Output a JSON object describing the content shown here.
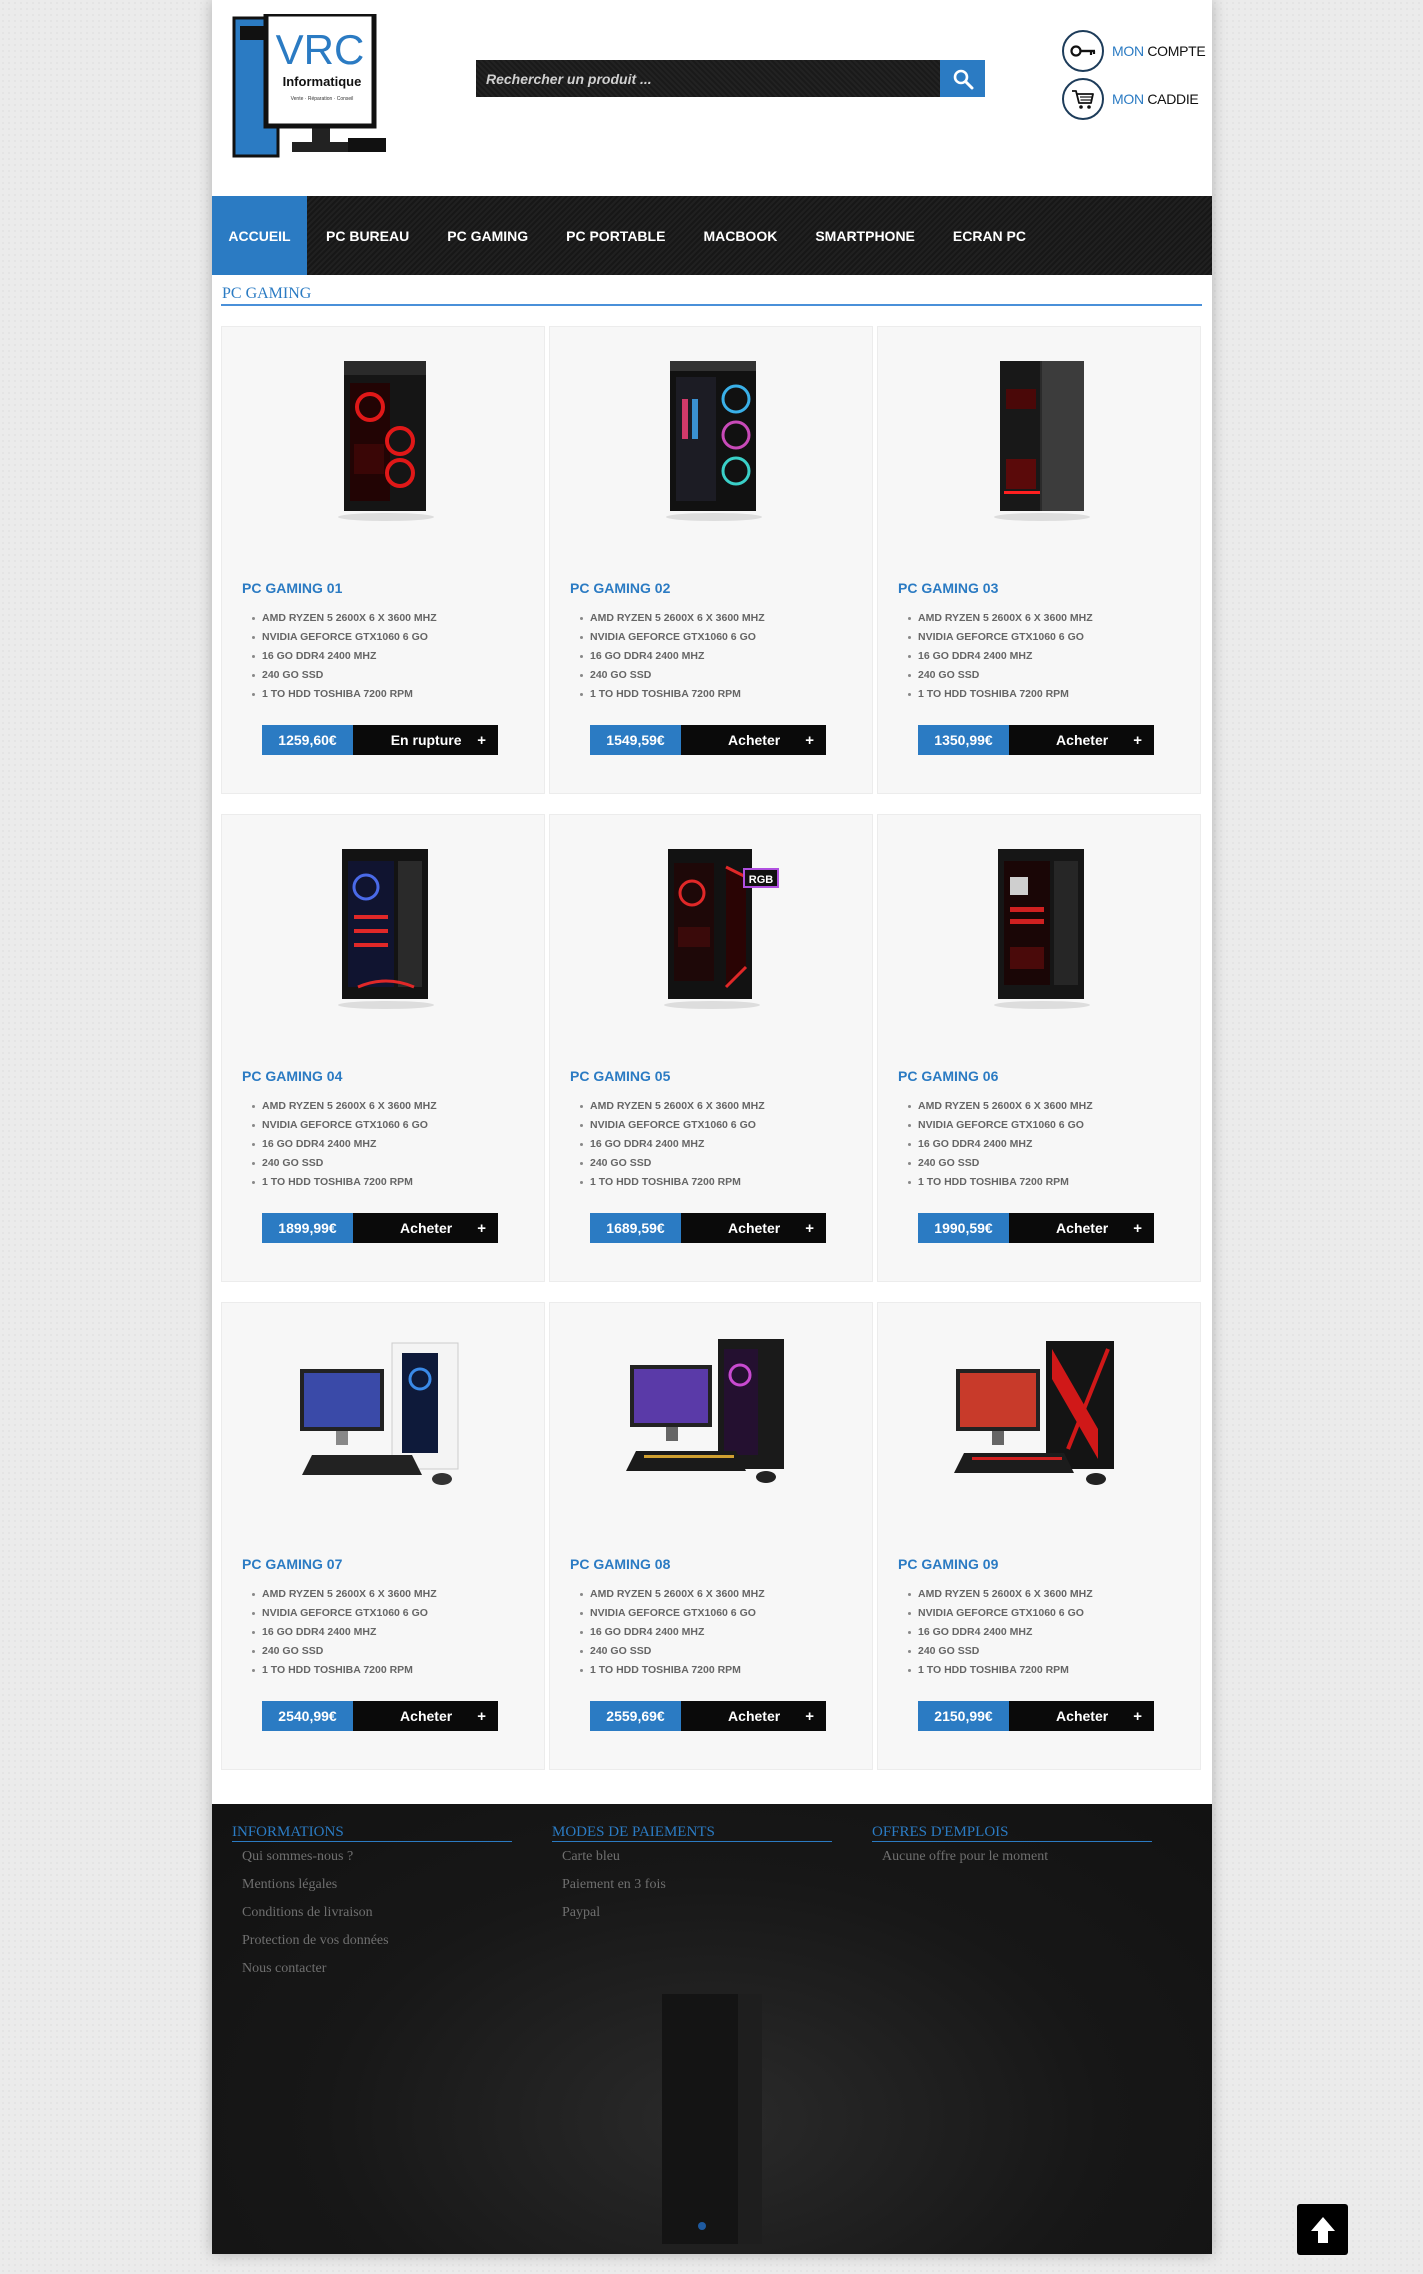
{
  "brand": {
    "logo_text": "VRC",
    "logo_sub": "Informatique",
    "logo_tagline": "Vente · Réparation · Conseil"
  },
  "search": {
    "placeholder": "Rechercher un produit ..."
  },
  "account": {
    "compte_prefix": "MON",
    "compte_label": "COMPTE",
    "caddie_prefix": "MON",
    "caddie_label": "CADDIE"
  },
  "nav": {
    "items": [
      {
        "label": "ACCUEIL"
      },
      {
        "label": "PC BUREAU"
      },
      {
        "label": "PC GAMING"
      },
      {
        "label": "PC PORTABLE"
      },
      {
        "label": "MACBOOK"
      },
      {
        "label": "SMARTPHONE"
      },
      {
        "label": "ECRAN PC"
      }
    ]
  },
  "section": {
    "title": "PC GAMING"
  },
  "products": [
    {
      "name": "PC GAMING 01",
      "price": "1259,60€",
      "action": "En rupture",
      "plus": "+",
      "specs": [
        "AMD RYZEN 5 2600X 6 X 3600 MHZ",
        "NVIDIA GEFORCE GTX1060 6 GO",
        "16 GO DDR4 2400 MHZ",
        "240 GO SSD",
        "1 TO HDD TOSHIBA 7200 RPM"
      ]
    },
    {
      "name": "PC GAMING 02",
      "price": "1549,59€",
      "action": "Acheter",
      "plus": "+",
      "specs": [
        "AMD RYZEN 5 2600X 6 X 3600 MHZ",
        "NVIDIA GEFORCE GTX1060 6 GO",
        "16 GO DDR4 2400 MHZ",
        "240 GO SSD",
        "1 TO HDD TOSHIBA 7200 RPM"
      ]
    },
    {
      "name": "PC GAMING 03",
      "price": "1350,99€",
      "action": "Acheter",
      "plus": "+",
      "specs": [
        "AMD RYZEN 5 2600X 6 X 3600 MHZ",
        "NVIDIA GEFORCE GTX1060 6 GO",
        "16 GO DDR4 2400 MHZ",
        "240 GO SSD",
        "1 TO HDD TOSHIBA 7200 RPM"
      ]
    },
    {
      "name": "PC GAMING 04",
      "price": "1899,99€",
      "action": "Acheter",
      "plus": "+",
      "specs": [
        "AMD RYZEN 5 2600X 6 X 3600 MHZ",
        "NVIDIA GEFORCE GTX1060 6 GO",
        "16 GO DDR4 2400 MHZ",
        "240 GO SSD",
        "1 TO HDD TOSHIBA 7200 RPM"
      ]
    },
    {
      "name": "PC GAMING 05",
      "price": "1689,59€",
      "action": "Acheter",
      "plus": "+",
      "badge": "RGB",
      "specs": [
        "AMD RYZEN 5 2600X 6 X 3600 MHZ",
        "NVIDIA GEFORCE GTX1060 6 GO",
        "16 GO DDR4 2400 MHZ",
        "240 GO SSD",
        "1 TO HDD TOSHIBA 7200 RPM"
      ]
    },
    {
      "name": "PC GAMING 06",
      "price": "1990,59€",
      "action": "Acheter",
      "plus": "+",
      "specs": [
        "AMD RYZEN 5 2600X 6 X 3600 MHZ",
        "NVIDIA GEFORCE GTX1060 6 GO",
        "16 GO DDR4 2400 MHZ",
        "240 GO SSD",
        "1 TO HDD TOSHIBA 7200 RPM"
      ]
    },
    {
      "name": "PC GAMING 07",
      "price": "2540,99€",
      "action": "Acheter",
      "plus": "+",
      "specs": [
        "AMD RYZEN 5 2600X 6 X 3600 MHZ",
        "NVIDIA GEFORCE GTX1060 6 GO",
        "16 GO DDR4 2400 MHZ",
        "240 GO SSD",
        "1 TO HDD TOSHIBA 7200 RPM"
      ]
    },
    {
      "name": "PC GAMING 08",
      "price": "2559,69€",
      "action": "Acheter",
      "plus": "+",
      "specs": [
        "AMD RYZEN 5 2600X 6 X 3600 MHZ",
        "NVIDIA GEFORCE GTX1060 6 GO",
        "16 GO DDR4 2400 MHZ",
        "240 GO SSD",
        "1 TO HDD TOSHIBA 7200 RPM"
      ]
    },
    {
      "name": "PC GAMING 09",
      "price": "2150,99€",
      "action": "Acheter",
      "plus": "+",
      "specs": [
        "AMD RYZEN 5 2600X 6 X 3600 MHZ",
        "NVIDIA GEFORCE GTX1060 6 GO",
        "16 GO DDR4 2400 MHZ",
        "240 GO SSD",
        "1 TO HDD TOSHIBA 7200 RPM"
      ]
    }
  ],
  "footer": {
    "informations": {
      "title": "INFORMATIONS",
      "links": [
        "Qui sommes-nous ?",
        "Mentions légales",
        "Conditions de livraison",
        "Protection de vos données",
        "Nous contacter"
      ]
    },
    "paiements": {
      "title": "MODES DE PAIEMENTS",
      "links": [
        "Carte bleu",
        "Paiement en 3 fois",
        "Paypal"
      ]
    },
    "emplois": {
      "title": "OFFRES D'EMPLOIS",
      "links": [
        "Aucune offre pour le moment"
      ]
    }
  },
  "colors": {
    "accent": "#2b7bc3",
    "nav_bg": "#1c1c1c",
    "footer_bg": "#161616",
    "card_bg": "#f7f7f7"
  },
  "icons": {
    "search": "search-icon",
    "account": "key-icon",
    "cart": "cart-icon",
    "back_to_top": "arrow-up-icon"
  }
}
